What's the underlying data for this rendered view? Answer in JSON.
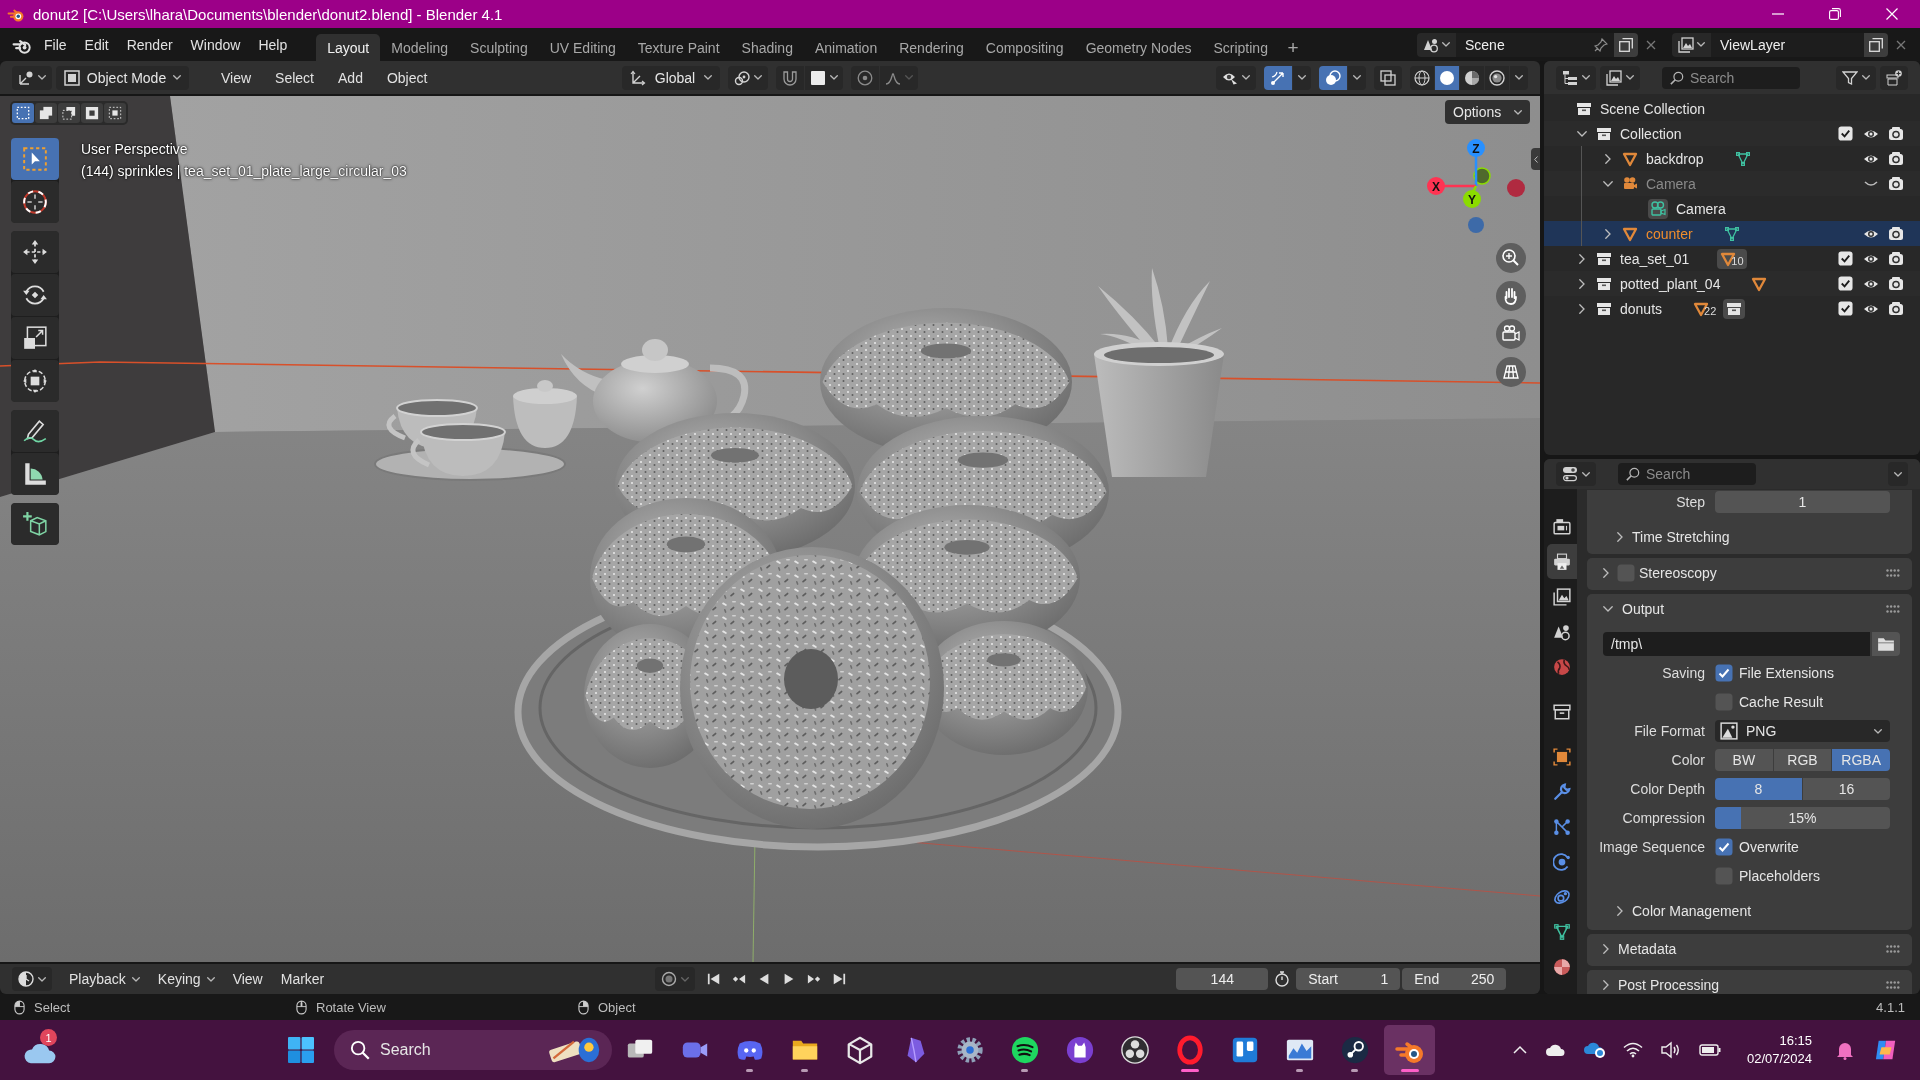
{
  "window": {
    "title": "donut2 [C:\\Users\\lhara\\Documents\\blender\\donut2.blend] - Blender 4.1"
  },
  "top_bar": {
    "menus": [
      "File",
      "Edit",
      "Render",
      "Window",
      "Help"
    ],
    "workspaces": [
      {
        "label": "Layout",
        "selected": true
      },
      {
        "label": "Modeling",
        "selected": false
      },
      {
        "label": "Sculpting",
        "selected": false
      },
      {
        "label": "UV Editing",
        "selected": false
      },
      {
        "label": "Texture Paint",
        "selected": false
      },
      {
        "label": "Shading",
        "selected": false
      },
      {
        "label": "Animation",
        "selected": false
      },
      {
        "label": "Rendering",
        "selected": false
      },
      {
        "label": "Compositing",
        "selected": false
      },
      {
        "label": "Geometry Nodes",
        "selected": false
      },
      {
        "label": "Scripting",
        "selected": false
      }
    ],
    "add_workspace": "+",
    "scene": "Scene",
    "view_layer": "ViewLayer"
  },
  "viewport_header": {
    "mode": "Object Mode",
    "menus": [
      "View",
      "Select",
      "Add",
      "Object"
    ],
    "orientation": "Global",
    "toggles": [
      {
        "kind": "gizmos",
        "on": true
      },
      {
        "kind": "overlays",
        "on": true
      },
      {
        "kind": "xray",
        "on": false
      }
    ],
    "shading": [
      {
        "kind": "wireframe",
        "selected": false
      },
      {
        "kind": "solid",
        "selected": true
      },
      {
        "kind": "material",
        "selected": false
      },
      {
        "kind": "rendered",
        "selected": false
      }
    ]
  },
  "viewport": {
    "select_modes": [
      {
        "kind": "set",
        "selected": true
      },
      {
        "kind": "extend",
        "selected": false
      },
      {
        "kind": "subtract",
        "selected": false
      },
      {
        "kind": "invert",
        "selected": false
      },
      {
        "kind": "intersect",
        "selected": false
      }
    ],
    "tool_groups": [
      {
        "tools": [
          {
            "kind": "select_box",
            "selected": true
          },
          {
            "kind": "cursor",
            "selected": false
          }
        ]
      },
      {
        "tools": [
          {
            "kind": "move",
            "selected": false
          },
          {
            "kind": "rotate",
            "selected": false
          },
          {
            "kind": "scale",
            "selected": false
          },
          {
            "kind": "transform",
            "selected": false
          }
        ]
      },
      {
        "tools": [
          {
            "kind": "annotate",
            "selected": false
          },
          {
            "kind": "measure",
            "selected": false
          }
        ]
      },
      {
        "tools": [
          {
            "kind": "add_cube",
            "selected": false
          }
        ]
      }
    ],
    "view_name": "User Perspective",
    "info": "(144) sprinkles | tea_set_01_plate_large_circular_03",
    "options": "Options",
    "gizmo": {
      "x": "X",
      "y": "Y",
      "z": "Z"
    },
    "nav_buttons": [
      {
        "kind": "zoom"
      },
      {
        "kind": "pan"
      },
      {
        "kind": "camera"
      },
      {
        "kind": "ortho"
      }
    ]
  },
  "outliner": {
    "search_placeholder": "Search",
    "tree": [
      {
        "name": "Scene Collection",
        "kind": "scene_collection",
        "selected": false,
        "children": [
          {
            "name": "Collection",
            "kind": "collection",
            "expanded": true,
            "checked": true,
            "visible": true,
            "selected": false,
            "children": [
              {
                "name": "backdrop",
                "kind": "mesh",
                "expanded": false,
                "visible": true,
                "selected": false,
                "extras": [
                  {
                    "kind": "mesh_data",
                    "highlighted": false
                  }
                ]
              },
              {
                "name": "Camera",
                "kind": "camera",
                "expanded": true,
                "visible": false,
                "selected": false,
                "children": [
                  {
                    "name": "Camera",
                    "kind": "camera_data",
                    "selected": false
                  }
                ]
              },
              {
                "name": "counter",
                "kind": "mesh",
                "expanded": false,
                "visible": true,
                "selected": true,
                "extras": [
                  {
                    "kind": "mesh_data",
                    "highlighted": false
                  }
                ]
              }
            ]
          },
          {
            "name": "tea_set_01",
            "kind": "collection",
            "expanded": false,
            "checked": true,
            "visible": true,
            "selected": false,
            "extras": [
              {
                "kind": "mesh",
                "count": "10",
                "highlighted": true
              }
            ]
          },
          {
            "name": "potted_plant_04",
            "kind": "collection",
            "expanded": false,
            "checked": true,
            "visible": true,
            "selected": false,
            "extras": [
              {
                "kind": "mesh",
                "highlighted": false
              }
            ]
          },
          {
            "name": "donuts",
            "kind": "collection",
            "expanded": false,
            "checked": true,
            "visible": true,
            "selected": false,
            "extras": [
              {
                "kind": "mesh",
                "count": "22",
                "highlighted": false
              },
              {
                "kind": "collection",
                "highlighted": true
              }
            ]
          }
        ]
      }
    ]
  },
  "properties": {
    "search_placeholder": "Search",
    "tab_groups": [
      {
        "tabs": [
          {
            "kind": "render",
            "selected": false
          },
          {
            "kind": "output",
            "selected": true
          },
          {
            "kind": "view_layer",
            "selected": false
          },
          {
            "kind": "scene",
            "selected": false
          },
          {
            "kind": "world",
            "selected": false
          }
        ]
      },
      {
        "tabs": [
          {
            "kind": "collection",
            "selected": false
          }
        ]
      },
      {
        "tabs": [
          {
            "kind": "object",
            "selected": false
          },
          {
            "kind": "modifiers",
            "selected": false
          },
          {
            "kind": "particles",
            "selected": false
          },
          {
            "kind": "physics",
            "selected": false
          },
          {
            "kind": "constraints",
            "selected": false
          },
          {
            "kind": "data",
            "selected": false
          },
          {
            "kind": "material",
            "selected": false
          }
        ]
      }
    ],
    "panels": [
      {
        "rows": [
          {
            "kind": "field",
            "label": "Step",
            "value": "1"
          },
          {
            "kind": "subpanel",
            "text": "Time Stretching",
            "expanded": false
          }
        ]
      },
      {
        "title": "Stereoscopy",
        "expanded": false,
        "checked": false
      },
      {
        "title": "Output",
        "expanded": true,
        "rows": [
          {
            "kind": "path",
            "value": "/tmp\\"
          },
          {
            "kind": "checkbox",
            "label": "Saving",
            "text": "File Extensions",
            "checked": true
          },
          {
            "kind": "checkbox",
            "text": "Cache Result",
            "checked": false
          },
          {
            "kind": "dropdown",
            "label": "File Format",
            "value": "PNG"
          },
          {
            "kind": "segmented",
            "label": "Color",
            "options": [
              {
                "label": "BW",
                "selected": false
              },
              {
                "label": "RGB",
                "selected": false
              },
              {
                "label": "RGBA",
                "selected": true
              }
            ]
          },
          {
            "kind": "segmented",
            "label": "Color Depth",
            "options": [
              {
                "label": "8",
                "selected": true
              },
              {
                "label": "16",
                "selected": false
              }
            ]
          },
          {
            "kind": "slider",
            "label": "Compression",
            "value": "15%",
            "level": 0.15
          },
          {
            "kind": "checkbox",
            "label": "Image Sequence",
            "text": "Overwrite",
            "checked": true
          },
          {
            "kind": "checkbox",
            "text": "Placeholders",
            "checked": false
          },
          {
            "kind": "subpanel",
            "text": "Color Management",
            "expanded": false
          }
        ]
      },
      {
        "title": "Metadata",
        "expanded": false
      },
      {
        "title": "Post Processing",
        "expanded": false
      }
    ]
  },
  "timeline": {
    "menus": [
      {
        "label": "Playback",
        "dropdown": true
      },
      {
        "label": "Keying",
        "dropdown": true
      },
      {
        "label": "View",
        "dropdown": false
      },
      {
        "label": "Marker",
        "dropdown": false
      }
    ],
    "transport": [
      {
        "kind": "jump_start"
      },
      {
        "kind": "prev_key"
      },
      {
        "kind": "play_reverse"
      },
      {
        "kind": "play"
      },
      {
        "kind": "next_key"
      },
      {
        "kind": "jump_end"
      }
    ],
    "current_frame": "144",
    "start": {
      "label": "Start",
      "value": "1"
    },
    "end": {
      "label": "End",
      "value": "250"
    }
  },
  "status_bar": {
    "hints": [
      {
        "kind": "left",
        "text": "Select"
      },
      {
        "kind": "middle",
        "text": "Rotate View"
      },
      {
        "kind": "right",
        "text": "Object"
      }
    ],
    "version": "4.1.1"
  },
  "taskbar": {
    "widget_badge": "1",
    "search_placeholder": "Search",
    "apps": [
      {
        "kind": "task_view",
        "running": false,
        "accent": false,
        "focused": false
      },
      {
        "kind": "video",
        "running": false,
        "accent": false,
        "focused": false
      },
      {
        "kind": "chat",
        "running": true,
        "accent": false,
        "focused": false
      },
      {
        "kind": "folder",
        "running": true,
        "accent": false,
        "focused": false
      },
      {
        "kind": "cube",
        "running": false,
        "accent": false,
        "focused": false
      },
      {
        "kind": "crystal",
        "running": false,
        "accent": false,
        "focused": false
      },
      {
        "kind": "gear",
        "running": false,
        "accent": false,
        "focused": false
      },
      {
        "kind": "music",
        "running": true,
        "accent": false,
        "focused": false
      },
      {
        "kind": "cat",
        "running": false,
        "accent": false,
        "focused": false
      },
      {
        "kind": "aperture",
        "running": false,
        "accent": false,
        "focused": false
      },
      {
        "kind": "browser",
        "running": true,
        "accent": true,
        "focused": false
      },
      {
        "kind": "board",
        "running": false,
        "accent": false,
        "focused": false
      },
      {
        "kind": "chart",
        "running": true,
        "accent": false,
        "focused": false
      },
      {
        "kind": "game_store",
        "running": true,
        "accent": false,
        "focused": false
      },
      {
        "kind": "blender",
        "running": true,
        "accent": true,
        "focused": true
      }
    ],
    "tray": [
      {
        "kind": "chevron"
      },
      {
        "kind": "cloud"
      },
      {
        "kind": "cloud_sync"
      },
      {
        "kind": "wifi"
      },
      {
        "kind": "speaker"
      },
      {
        "kind": "battery"
      }
    ],
    "time": "16:15",
    "date": "02/07/2024",
    "end_icons": [
      {
        "kind": "bell"
      },
      {
        "kind": "assistant"
      }
    ]
  }
}
